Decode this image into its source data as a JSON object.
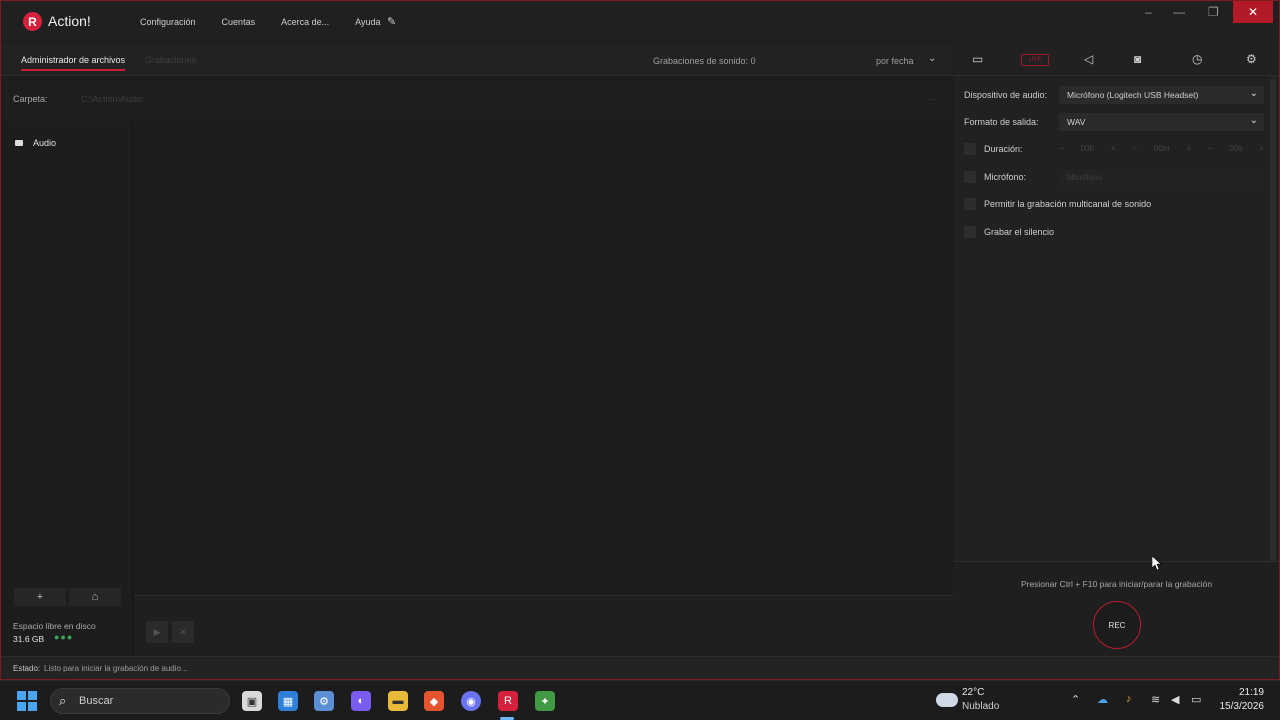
{
  "window": {
    "app_name": "Action!",
    "menu": [
      "Configuración",
      "Cuentas",
      "Acerca de...",
      "Ayuda"
    ],
    "min_glyph": "–",
    "max_glyph": "—",
    "restore_glyph": "❐",
    "close_glyph": "✕"
  },
  "file_manager": {
    "tab_active": "Administrador de archivos",
    "tab_inactive": "Grabaciones",
    "rec_count": "Grabaciones de sonido: 0",
    "sort": "por fecha",
    "folder_label": "Carpeta:",
    "folder_path": "C:\\Action\\Audio",
    "folder_dots": "...",
    "sidebar_item": "Audio",
    "add_button": "+",
    "folder_button": "⌂",
    "disk_label": "Espacio libre en disco",
    "disk_value": "31.6 GB",
    "play_glyph": "▶",
    "stop_glyph": "✕"
  },
  "audio_settings": {
    "device_label": "Dispositivo de audio:",
    "device_value": "Micrófono (Logitech USB Headset)",
    "format_label": "Formato de salida:",
    "format_value": "WAV",
    "duration_label": "Duración:",
    "duration_h": "00h",
    "duration_m": "00m",
    "duration_s": "00s",
    "mic_label": "Micrófono:",
    "mic_value": "Micrófono",
    "multichannel_label": "Permitir la grabación multicanal de sonido",
    "silence_label": "Grabar el silencio",
    "hint": "Presionar Ctrl + F10 para iniciar/parar la grabación",
    "rec_button": "REC",
    "tab_rec_label": "LIVE"
  },
  "status": {
    "label": "Estado:",
    "text": "Listo para iniciar la grabación de audio..."
  },
  "taskbar": {
    "search": "Buscar",
    "temp": "22°C",
    "weather": "Nublado",
    "time": "21:19",
    "date": "15/3/2026"
  },
  "colors": {
    "accent": "#c81f34",
    "background": "#1f1f1f",
    "disk_indicator": "#3aa65c"
  }
}
